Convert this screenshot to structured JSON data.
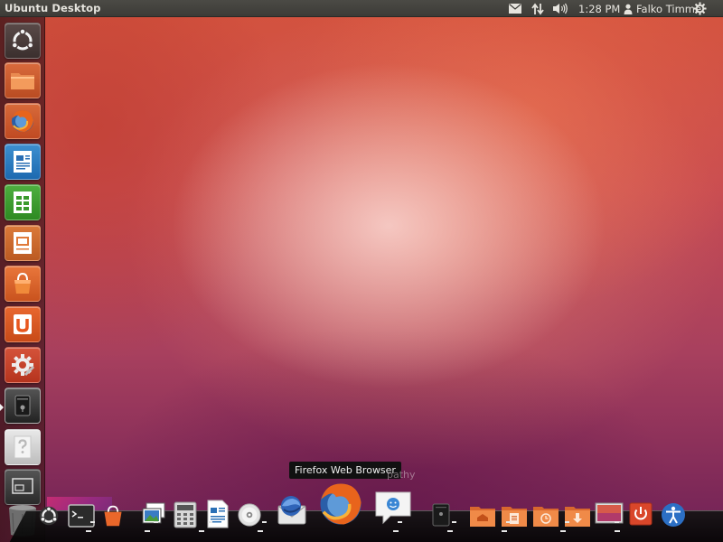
{
  "top_panel": {
    "window_title": "Ubuntu Desktop",
    "clock": "1:28 PM",
    "user_name": "Falko Timme",
    "icons": [
      "mail-icon",
      "network-icon",
      "volume-icon",
      "user-icon",
      "gear-icon"
    ]
  },
  "launcher": {
    "items": [
      {
        "name": "dash-home",
        "icon": "ubuntu-logo-icon"
      },
      {
        "name": "home-folder",
        "icon": "folder-icon"
      },
      {
        "name": "firefox",
        "icon": "firefox-icon"
      },
      {
        "name": "libreoffice-writer",
        "icon": "writer-icon"
      },
      {
        "name": "libreoffice-calc",
        "icon": "calc-icon"
      },
      {
        "name": "libreoffice-impress",
        "icon": "impress-icon"
      },
      {
        "name": "ubuntu-software-center",
        "icon": "software-center-icon"
      },
      {
        "name": "ubuntu-one",
        "icon": "ubuntu-one-icon"
      },
      {
        "name": "system-settings",
        "icon": "settings-icon"
      },
      {
        "name": "cairo-dock",
        "icon": "dock-icon"
      },
      {
        "name": "help",
        "icon": "help-icon"
      },
      {
        "name": "workspace-switcher",
        "icon": "workspaces-icon"
      },
      {
        "name": "trash",
        "icon": "trash-icon"
      }
    ],
    "colors": {
      "orange": "#e8571e",
      "green": "#3a9a2c",
      "blue": "#1e73be"
    }
  },
  "dock": {
    "tooltip": "Firefox Web Browser",
    "tooltip_ghost": "pathy",
    "items": [
      "ubuntu-logo-icon",
      "terminal-icon",
      "software-center-icon",
      "image-viewer-icon",
      "calculator-icon",
      "writer-icon",
      "cd-icon",
      "thunderbird-icon",
      "firefox-icon",
      "empathy-icon",
      "camera-icon",
      "home-folder-icon",
      "documents-folder-icon",
      "recent-folder-icon",
      "downloads-folder-icon",
      "desktop-icon",
      "power-icon",
      "accessibility-icon"
    ]
  }
}
